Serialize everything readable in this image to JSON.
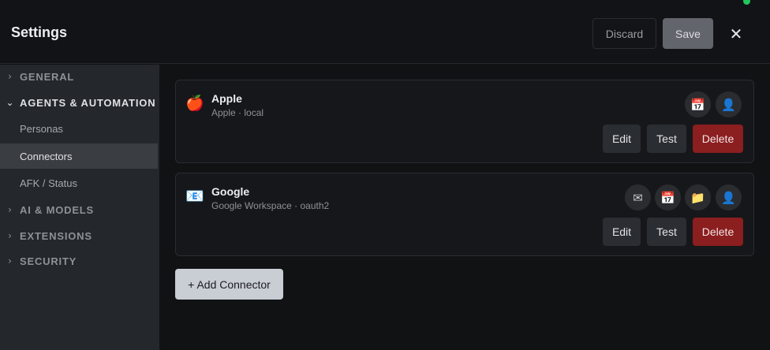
{
  "header": {
    "title": "Settings",
    "discard_label": "Discard",
    "save_label": "Save",
    "close_glyph": "✕"
  },
  "sidebar": {
    "groups": [
      {
        "label": "GENERAL",
        "chevron": "›",
        "expanded": false
      },
      {
        "label": "AGENTS & AUTOMATION",
        "chevron": "⌄",
        "expanded": true
      },
      {
        "label": "AI & MODELS",
        "chevron": "›",
        "expanded": false
      },
      {
        "label": "EXTENSIONS",
        "chevron": "›",
        "expanded": false
      },
      {
        "label": "SECURITY",
        "chevron": "›",
        "expanded": false
      }
    ],
    "items": [
      {
        "label": "Personas",
        "active": false
      },
      {
        "label": "Connectors",
        "active": true
      },
      {
        "label": "AFK / Status",
        "active": false
      }
    ]
  },
  "connectors": [
    {
      "icon": "apple-icon",
      "icon_glyph": "🍎",
      "name": "Apple",
      "subtitle": "Apple · local",
      "capabilities": [
        {
          "icon": "calendar-icon",
          "glyph": "📅"
        },
        {
          "icon": "contacts-icon",
          "glyph": "👤"
        }
      ],
      "edit_label": "Edit",
      "test_label": "Test",
      "delete_label": "Delete"
    },
    {
      "icon": "email-icon",
      "icon_glyph": "📧",
      "name": "Google",
      "subtitle": "Google Workspace · oauth2",
      "capabilities": [
        {
          "icon": "mail-icon",
          "glyph": "✉"
        },
        {
          "icon": "calendar-icon",
          "glyph": "📅"
        },
        {
          "icon": "folder-icon",
          "glyph": "📁"
        },
        {
          "icon": "contacts-icon",
          "glyph": "👤"
        }
      ],
      "edit_label": "Edit",
      "test_label": "Test",
      "delete_label": "Delete"
    }
  ],
  "add_connector_label": "+ Add Connector",
  "colors": {
    "accent_delete": "#8b1e1f",
    "status_online": "#22c55e",
    "sidebar_bg": "#24272b",
    "main_bg": "#111214"
  }
}
